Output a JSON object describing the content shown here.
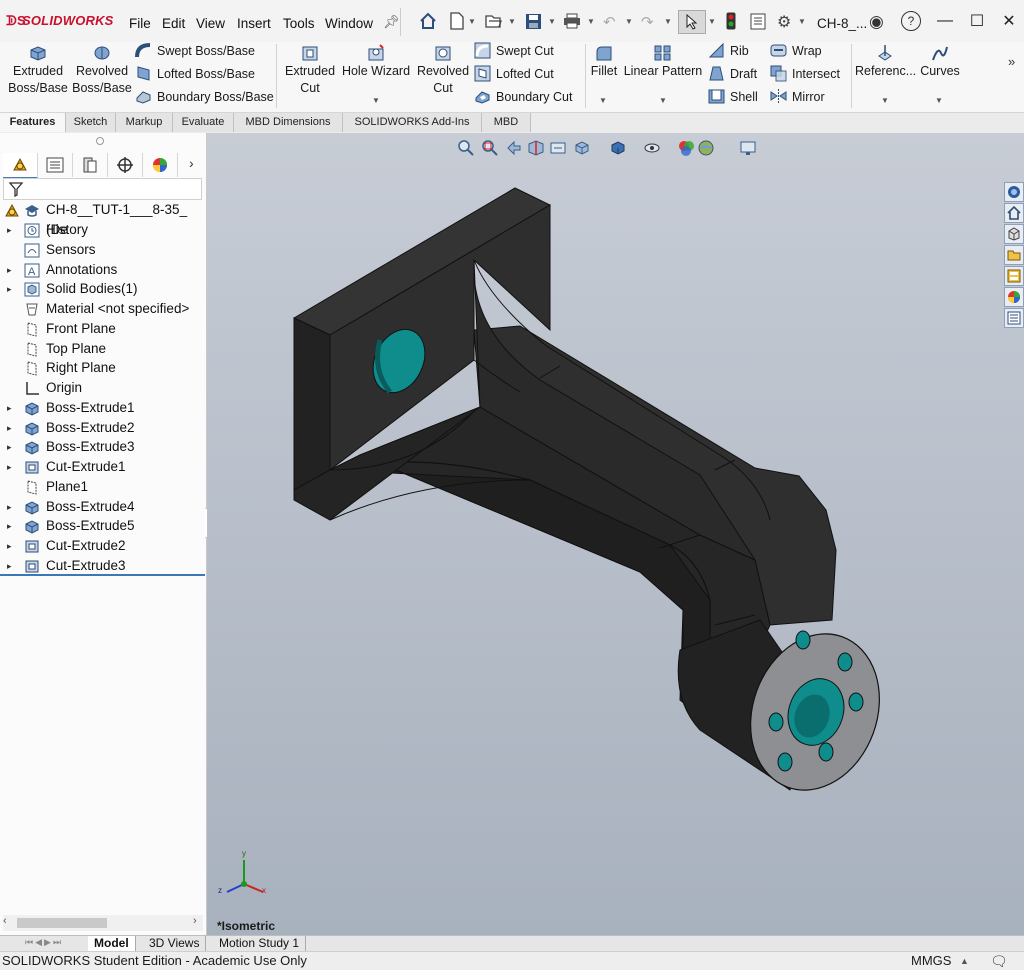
{
  "app": {
    "brand": "SOLIDWORKS",
    "document_title": "CH-8_..."
  },
  "menu": [
    "File",
    "Edit",
    "View",
    "Insert",
    "Tools",
    "Window"
  ],
  "command_manager": {
    "extruded_boss": "Extruded\nBoss/Base",
    "revolved_boss": "Revolved\nBoss/Base",
    "swept_boss": "Swept Boss/Base",
    "lofted_boss": "Lofted Boss/Base",
    "boundary_boss": "Boundary Boss/Base",
    "extruded_cut": "Extruded\nCut",
    "hole_wizard": "Hole Wizard",
    "revolved_cut": "Revolved\nCut",
    "swept_cut": "Swept Cut",
    "lofted_cut": "Lofted Cut",
    "boundary_cut": "Boundary Cut",
    "fillet": "Fillet",
    "linear_pattern": "Linear Pattern",
    "rib": "Rib",
    "draft": "Draft",
    "shell": "Shell",
    "wrap": "Wrap",
    "intersect": "Intersect",
    "mirror": "Mirror",
    "reference": "Referenc...",
    "curves": "Curves"
  },
  "tabs": [
    "Features",
    "Sketch",
    "Markup",
    "Evaluate",
    "MBD Dimensions",
    "SOLIDWORKS Add-Ins",
    "MBD"
  ],
  "active_tab": "Features",
  "feature_tree": {
    "root": "CH-8__TUT-1___8-35_ (De",
    "items": [
      {
        "label": "History",
        "icon": "history-icon",
        "expandable": true
      },
      {
        "label": "Sensors",
        "icon": "sensors-icon",
        "expandable": false
      },
      {
        "label": "Annotations",
        "icon": "annotations-icon",
        "expandable": true
      },
      {
        "label": "Solid Bodies(1)",
        "icon": "solid-bodies-icon",
        "expandable": true
      },
      {
        "label": "Material <not specified>",
        "icon": "material-icon",
        "expandable": false
      },
      {
        "label": "Front Plane",
        "icon": "plane-icon",
        "expandable": false
      },
      {
        "label": "Top Plane",
        "icon": "plane-icon",
        "expandable": false
      },
      {
        "label": "Right Plane",
        "icon": "plane-icon",
        "expandable": false
      },
      {
        "label": "Origin",
        "icon": "origin-icon",
        "expandable": false
      },
      {
        "label": "Boss-Extrude1",
        "icon": "boss-extrude-icon",
        "expandable": true
      },
      {
        "label": "Boss-Extrude2",
        "icon": "boss-extrude-icon",
        "expandable": true
      },
      {
        "label": "Boss-Extrude3",
        "icon": "boss-extrude-icon",
        "expandable": true
      },
      {
        "label": "Cut-Extrude1",
        "icon": "cut-extrude-icon",
        "expandable": true
      },
      {
        "label": "Plane1",
        "icon": "plane-icon",
        "expandable": false
      },
      {
        "label": "Boss-Extrude4",
        "icon": "boss-extrude-icon",
        "expandable": true
      },
      {
        "label": "Boss-Extrude5",
        "icon": "boss-extrude-icon",
        "expandable": true
      },
      {
        "label": "Cut-Extrude2",
        "icon": "cut-extrude-icon",
        "expandable": true
      },
      {
        "label": "Cut-Extrude3",
        "icon": "cut-extrude-icon",
        "expandable": true
      }
    ]
  },
  "viewport": {
    "view_label": "*Isometric",
    "triad": {
      "x": "x",
      "y": "y",
      "z": "z"
    }
  },
  "bottom_tabs": [
    "Model",
    "3D Views",
    "Motion Study 1"
  ],
  "active_bottom_tab": "Model",
  "status": {
    "text": "SOLIDWORKS Student Edition - Academic Use Only",
    "units": "MMGS"
  },
  "colors": {
    "accent_red": "#c8102e",
    "model_dark": "#2b2b2b",
    "hole_teal": "#0f8d8d",
    "viewport_top": "#c7ccd5"
  }
}
